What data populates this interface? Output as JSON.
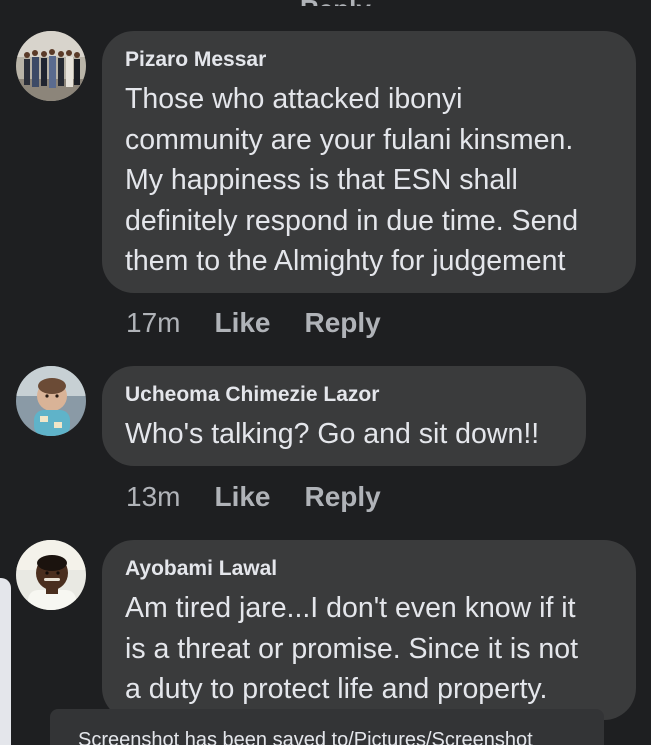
{
  "comments": [
    {
      "author": "Pizaro Messar",
      "lines": [
        "Those who attacked ibonyi",
        "community are your fulani kinsmen.",
        "My happiness is that ESN shall",
        "definitely respond in due time. Send",
        "them to the Almighty for judgement"
      ],
      "time": "17m",
      "like_label": "Like",
      "reply_label": "Reply"
    },
    {
      "author": "Ucheoma Chimezie Lazor",
      "lines": [
        "Who's talking? Go and sit down!!"
      ],
      "time": "13m",
      "like_label": "Like",
      "reply_label": "Reply"
    },
    {
      "author": "Ayobami Lawal",
      "lines": [
        "Am tired jare...I don't even know if it",
        "is a threat or promise. Since it is not",
        "a duty to protect life and property."
      ]
    }
  ],
  "toast": {
    "message": "Screenshot has been saved to/Pictures/Screenshot"
  },
  "colors": {
    "background": "#1e1f21",
    "bubble": "#3a3b3c",
    "primary_text": "#e4e6eb",
    "secondary_text": "#b0b3b8"
  }
}
